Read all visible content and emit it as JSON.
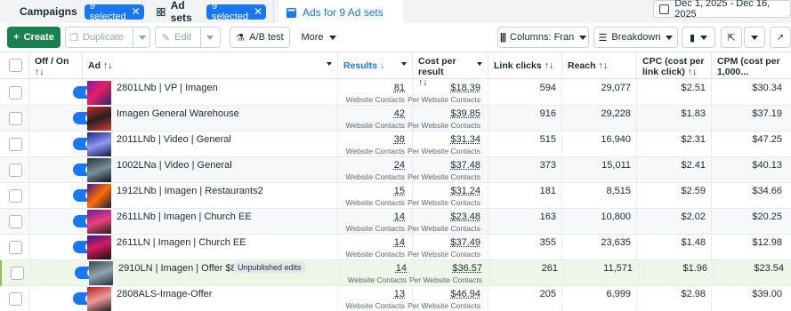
{
  "tabs": {
    "campaigns": {
      "label": "Campaigns",
      "badge": "9 selected"
    },
    "adsets": {
      "label": "Ad sets",
      "badge": "9 selected"
    },
    "ads": {
      "label": "Ads for 9 Ad sets"
    }
  },
  "date_range": "Dec 1, 2025 - Dec 16, 2025",
  "toolbar": {
    "create": "Create",
    "duplicate": "Duplicate",
    "edit": "Edit",
    "ab_test": "A/B test",
    "more": "More",
    "columns": "Columns: Fran",
    "breakdown": "Breakdown"
  },
  "columns": {
    "off_on": "Off / On",
    "off_on_sort": "↑↓",
    "ad": "Ad ↑↓",
    "results": "Results ↓",
    "cost_per_result": "Cost per result",
    "cost_sort": "↑↓",
    "link_clicks": "Link clicks ↑↓",
    "reach": "Reach ↑↓",
    "cpc": "CPC (cost per",
    "cpc2": "link click) ↑↓",
    "cpm": "CPM (cost per",
    "cpm2": "1,000..."
  },
  "result_type": "Website Contacts",
  "cost_type": "Per Website Contacts",
  "rows": [
    {
      "name": "2801LNb | VP | Imagen",
      "results": "81",
      "cost": "$18.39",
      "clicks": "594",
      "reach": "29,077",
      "cpc": "$2.51",
      "cpm": "$30.34"
    },
    {
      "name": "Imagen General Warehouse",
      "results": "42",
      "cost": "$39.85",
      "clicks": "916",
      "reach": "29,228",
      "cpc": "$1.83",
      "cpm": "$37.19"
    },
    {
      "name": "2011LNb | Video | General",
      "results": "38",
      "cost": "$31.34",
      "clicks": "515",
      "reach": "16,940",
      "cpc": "$2.31",
      "cpm": "$47.25"
    },
    {
      "name": "1002LNa | Video | General",
      "results": "24",
      "cost": "$37.48",
      "clicks": "373",
      "reach": "15,011",
      "cpc": "$2.41",
      "cpm": "$40.13"
    },
    {
      "name": "1912LNb | Imagen | Restaurants2",
      "results": "15",
      "cost": "$31.24",
      "clicks": "181",
      "reach": "8,515",
      "cpc": "$2.59",
      "cpm": "$34.66"
    },
    {
      "name": "2611LNb | Imagen | Church EE",
      "results": "14",
      "cost": "$23.48",
      "clicks": "163",
      "reach": "10,800",
      "cpc": "$2.02",
      "cpm": "$20.25"
    },
    {
      "name": "2611LN | Imagen | Church EE",
      "results": "14",
      "cost": "$37.49",
      "clicks": "355",
      "reach": "23,635",
      "cpc": "$1.48",
      "cpm": "$12.98"
    },
    {
      "name": "2910LN | Imagen | Offer $8699",
      "badge": "Unpublished edits",
      "results": "14",
      "cost": "$36.57",
      "clicks": "261",
      "reach": "11,571",
      "cpc": "$1.96",
      "cpm": "$23.54"
    },
    {
      "name": "2808ALS-Image-Offer",
      "results": "13",
      "cost": "$46.94",
      "clicks": "205",
      "reach": "6,999",
      "cpc": "$2.98",
      "cpm": "$39.00"
    }
  ],
  "colors": {
    "accent": "#1877f2",
    "create": "#1b7f4f"
  }
}
